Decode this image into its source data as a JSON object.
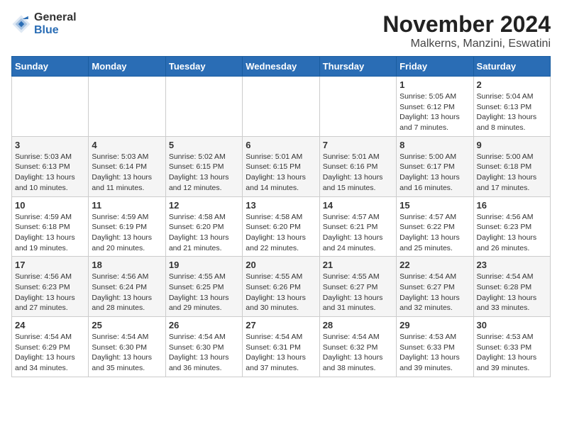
{
  "logo": {
    "general": "General",
    "blue": "Blue"
  },
  "title": "November 2024",
  "subtitle": "Malkerns, Manzini, Eswatini",
  "weekdays": [
    "Sunday",
    "Monday",
    "Tuesday",
    "Wednesday",
    "Thursday",
    "Friday",
    "Saturday"
  ],
  "weeks": [
    [
      {
        "date": "",
        "content": ""
      },
      {
        "date": "",
        "content": ""
      },
      {
        "date": "",
        "content": ""
      },
      {
        "date": "",
        "content": ""
      },
      {
        "date": "",
        "content": ""
      },
      {
        "date": "1",
        "content": "Sunrise: 5:05 AM\nSunset: 6:12 PM\nDaylight: 13 hours and 7 minutes."
      },
      {
        "date": "2",
        "content": "Sunrise: 5:04 AM\nSunset: 6:13 PM\nDaylight: 13 hours and 8 minutes."
      }
    ],
    [
      {
        "date": "3",
        "content": "Sunrise: 5:03 AM\nSunset: 6:13 PM\nDaylight: 13 hours and 10 minutes."
      },
      {
        "date": "4",
        "content": "Sunrise: 5:03 AM\nSunset: 6:14 PM\nDaylight: 13 hours and 11 minutes."
      },
      {
        "date": "5",
        "content": "Sunrise: 5:02 AM\nSunset: 6:15 PM\nDaylight: 13 hours and 12 minutes."
      },
      {
        "date": "6",
        "content": "Sunrise: 5:01 AM\nSunset: 6:15 PM\nDaylight: 13 hours and 14 minutes."
      },
      {
        "date": "7",
        "content": "Sunrise: 5:01 AM\nSunset: 6:16 PM\nDaylight: 13 hours and 15 minutes."
      },
      {
        "date": "8",
        "content": "Sunrise: 5:00 AM\nSunset: 6:17 PM\nDaylight: 13 hours and 16 minutes."
      },
      {
        "date": "9",
        "content": "Sunrise: 5:00 AM\nSunset: 6:18 PM\nDaylight: 13 hours and 17 minutes."
      }
    ],
    [
      {
        "date": "10",
        "content": "Sunrise: 4:59 AM\nSunset: 6:18 PM\nDaylight: 13 hours and 19 minutes."
      },
      {
        "date": "11",
        "content": "Sunrise: 4:59 AM\nSunset: 6:19 PM\nDaylight: 13 hours and 20 minutes."
      },
      {
        "date": "12",
        "content": "Sunrise: 4:58 AM\nSunset: 6:20 PM\nDaylight: 13 hours and 21 minutes."
      },
      {
        "date": "13",
        "content": "Sunrise: 4:58 AM\nSunset: 6:20 PM\nDaylight: 13 hours and 22 minutes."
      },
      {
        "date": "14",
        "content": "Sunrise: 4:57 AM\nSunset: 6:21 PM\nDaylight: 13 hours and 24 minutes."
      },
      {
        "date": "15",
        "content": "Sunrise: 4:57 AM\nSunset: 6:22 PM\nDaylight: 13 hours and 25 minutes."
      },
      {
        "date": "16",
        "content": "Sunrise: 4:56 AM\nSunset: 6:23 PM\nDaylight: 13 hours and 26 minutes."
      }
    ],
    [
      {
        "date": "17",
        "content": "Sunrise: 4:56 AM\nSunset: 6:23 PM\nDaylight: 13 hours and 27 minutes."
      },
      {
        "date": "18",
        "content": "Sunrise: 4:56 AM\nSunset: 6:24 PM\nDaylight: 13 hours and 28 minutes."
      },
      {
        "date": "19",
        "content": "Sunrise: 4:55 AM\nSunset: 6:25 PM\nDaylight: 13 hours and 29 minutes."
      },
      {
        "date": "20",
        "content": "Sunrise: 4:55 AM\nSunset: 6:26 PM\nDaylight: 13 hours and 30 minutes."
      },
      {
        "date": "21",
        "content": "Sunrise: 4:55 AM\nSunset: 6:27 PM\nDaylight: 13 hours and 31 minutes."
      },
      {
        "date": "22",
        "content": "Sunrise: 4:54 AM\nSunset: 6:27 PM\nDaylight: 13 hours and 32 minutes."
      },
      {
        "date": "23",
        "content": "Sunrise: 4:54 AM\nSunset: 6:28 PM\nDaylight: 13 hours and 33 minutes."
      }
    ],
    [
      {
        "date": "24",
        "content": "Sunrise: 4:54 AM\nSunset: 6:29 PM\nDaylight: 13 hours and 34 minutes."
      },
      {
        "date": "25",
        "content": "Sunrise: 4:54 AM\nSunset: 6:30 PM\nDaylight: 13 hours and 35 minutes."
      },
      {
        "date": "26",
        "content": "Sunrise: 4:54 AM\nSunset: 6:30 PM\nDaylight: 13 hours and 36 minutes."
      },
      {
        "date": "27",
        "content": "Sunrise: 4:54 AM\nSunset: 6:31 PM\nDaylight: 13 hours and 37 minutes."
      },
      {
        "date": "28",
        "content": "Sunrise: 4:54 AM\nSunset: 6:32 PM\nDaylight: 13 hours and 38 minutes."
      },
      {
        "date": "29",
        "content": "Sunrise: 4:53 AM\nSunset: 6:33 PM\nDaylight: 13 hours and 39 minutes."
      },
      {
        "date": "30",
        "content": "Sunrise: 4:53 AM\nSunset: 6:33 PM\nDaylight: 13 hours and 39 minutes."
      }
    ]
  ]
}
